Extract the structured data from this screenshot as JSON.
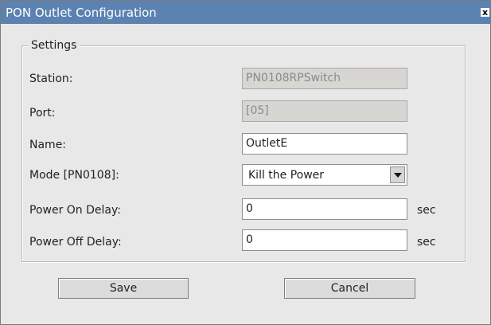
{
  "dialog": {
    "title": "PON Outlet Configuration",
    "close_label": "x"
  },
  "settings": {
    "legend": "Settings",
    "station": {
      "label": "Station:",
      "value": "PN0108RPSwitch"
    },
    "port": {
      "label": "Port:",
      "value": "[05]"
    },
    "name": {
      "label": "Name:",
      "value": "OutletE"
    },
    "mode": {
      "label": "Mode [PN0108]:",
      "value": "Kill the Power"
    },
    "power_on_delay": {
      "label": "Power On Delay:",
      "value": "0",
      "unit": "sec"
    },
    "power_off_delay": {
      "label": "Power Off Delay:",
      "value": "0",
      "unit": "sec"
    }
  },
  "buttons": {
    "save": "Save",
    "cancel": "Cancel"
  }
}
